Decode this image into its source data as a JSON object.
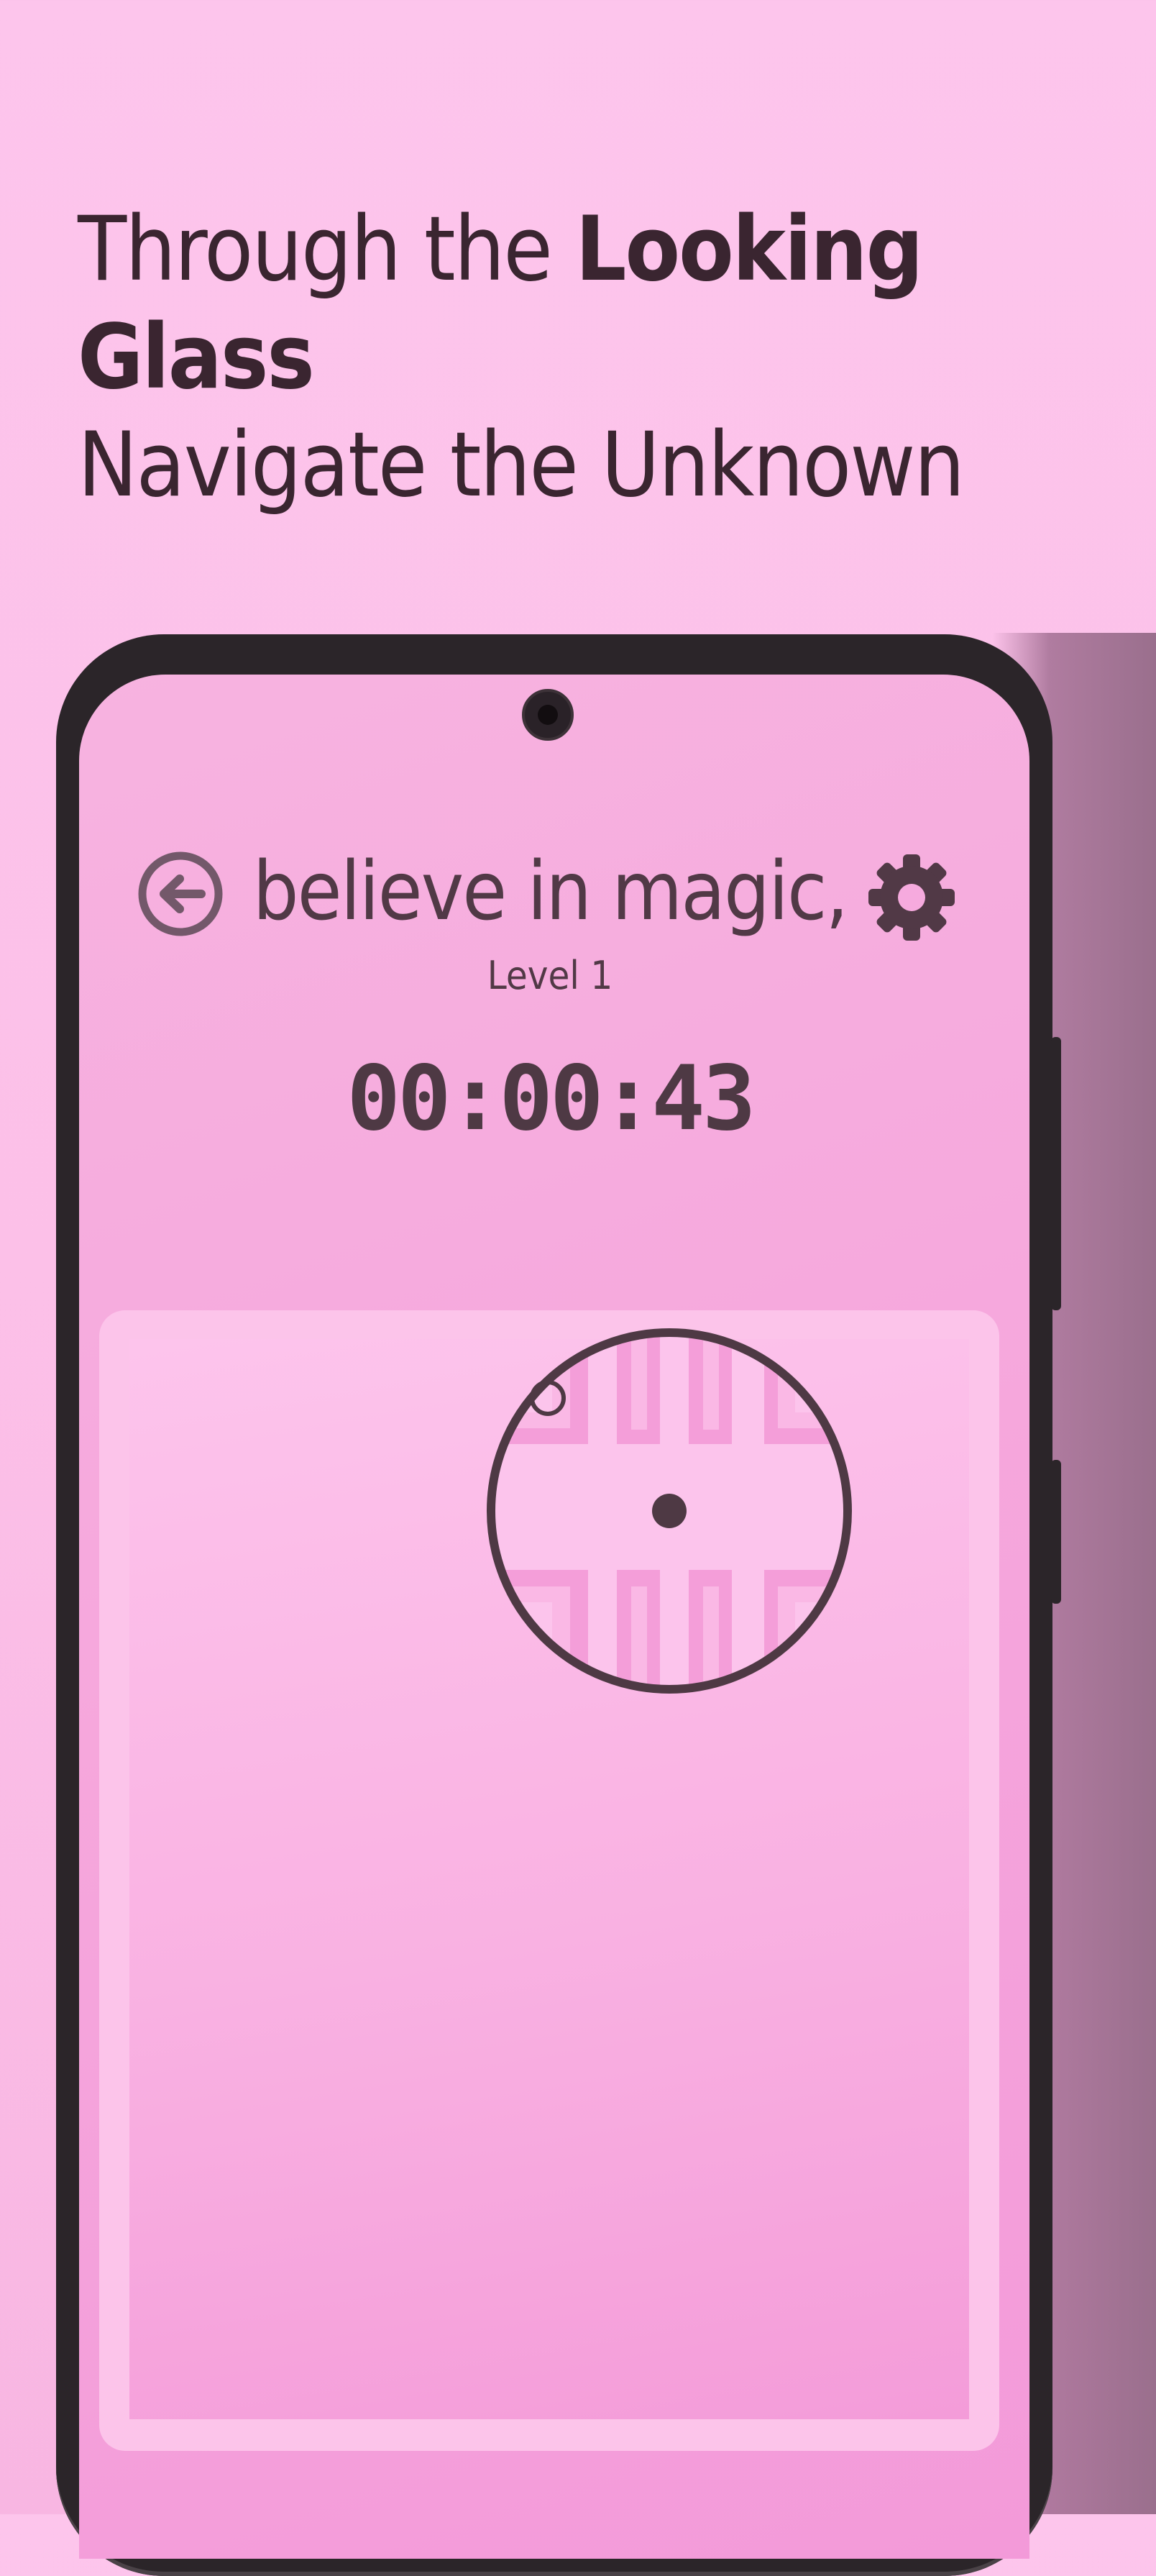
{
  "headline": {
    "line1_prefix": "Through the ",
    "line1_bold": "Looking Glass",
    "line2": "Navigate the Unknown"
  },
  "game": {
    "title": "believe in magic,",
    "level": "Level 1",
    "timer": "00:00:43"
  },
  "icons": {
    "back": "arrow-left-circle-icon",
    "settings": "gear-icon"
  },
  "colors": {
    "background": "#fcc0e8",
    "screen": "#f6a9dd",
    "text": "#4e3944",
    "maze_wall": "#f39ad9",
    "lens_ring": "#4e3944"
  }
}
